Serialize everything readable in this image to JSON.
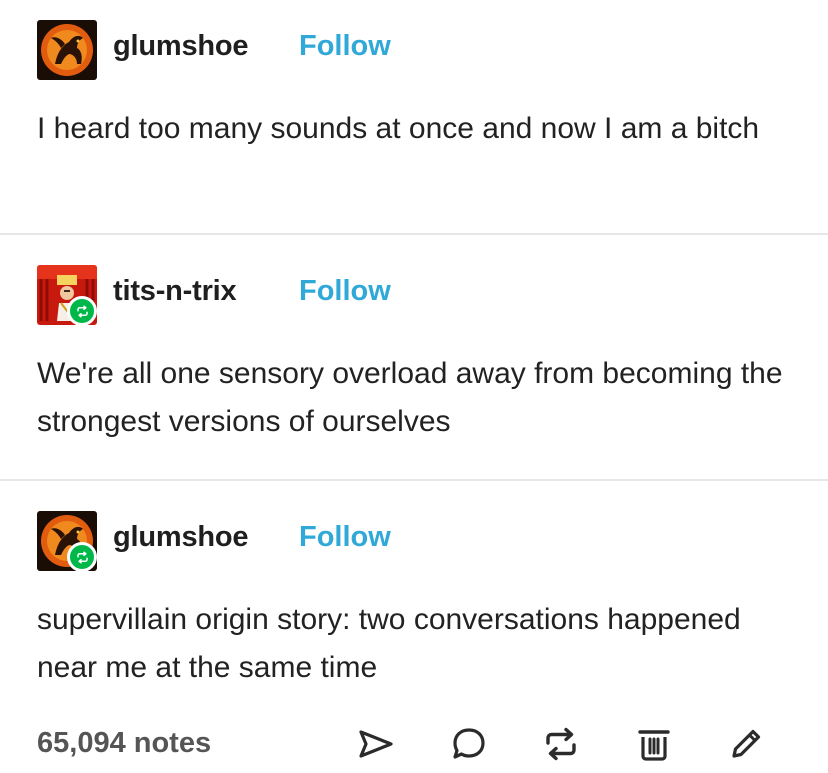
{
  "posts": [
    {
      "username": "glumshoe",
      "follow_label": "Follow",
      "text": "I heard too many sounds at once and now I am a bitch",
      "reblogged": false
    },
    {
      "username": "tits-n-trix",
      "follow_label": "Follow",
      "text": "We're all one sensory overload away from becoming the strongest versions of ourselves",
      "reblogged": true
    },
    {
      "username": "glumshoe",
      "follow_label": "Follow",
      "text": "supervillain origin story: two conversations happened near me at the same time",
      "reblogged": true
    }
  ],
  "footer": {
    "notes": "65,094 notes",
    "actions": [
      "share-icon",
      "reply-icon",
      "reblog-icon",
      "delete-icon",
      "edit-icon"
    ]
  },
  "colors": {
    "follow": "#30a9d8",
    "reblog_badge": "#00b84a",
    "text": "#222222",
    "notes": "#555555",
    "divider": "#e6e6e6"
  }
}
